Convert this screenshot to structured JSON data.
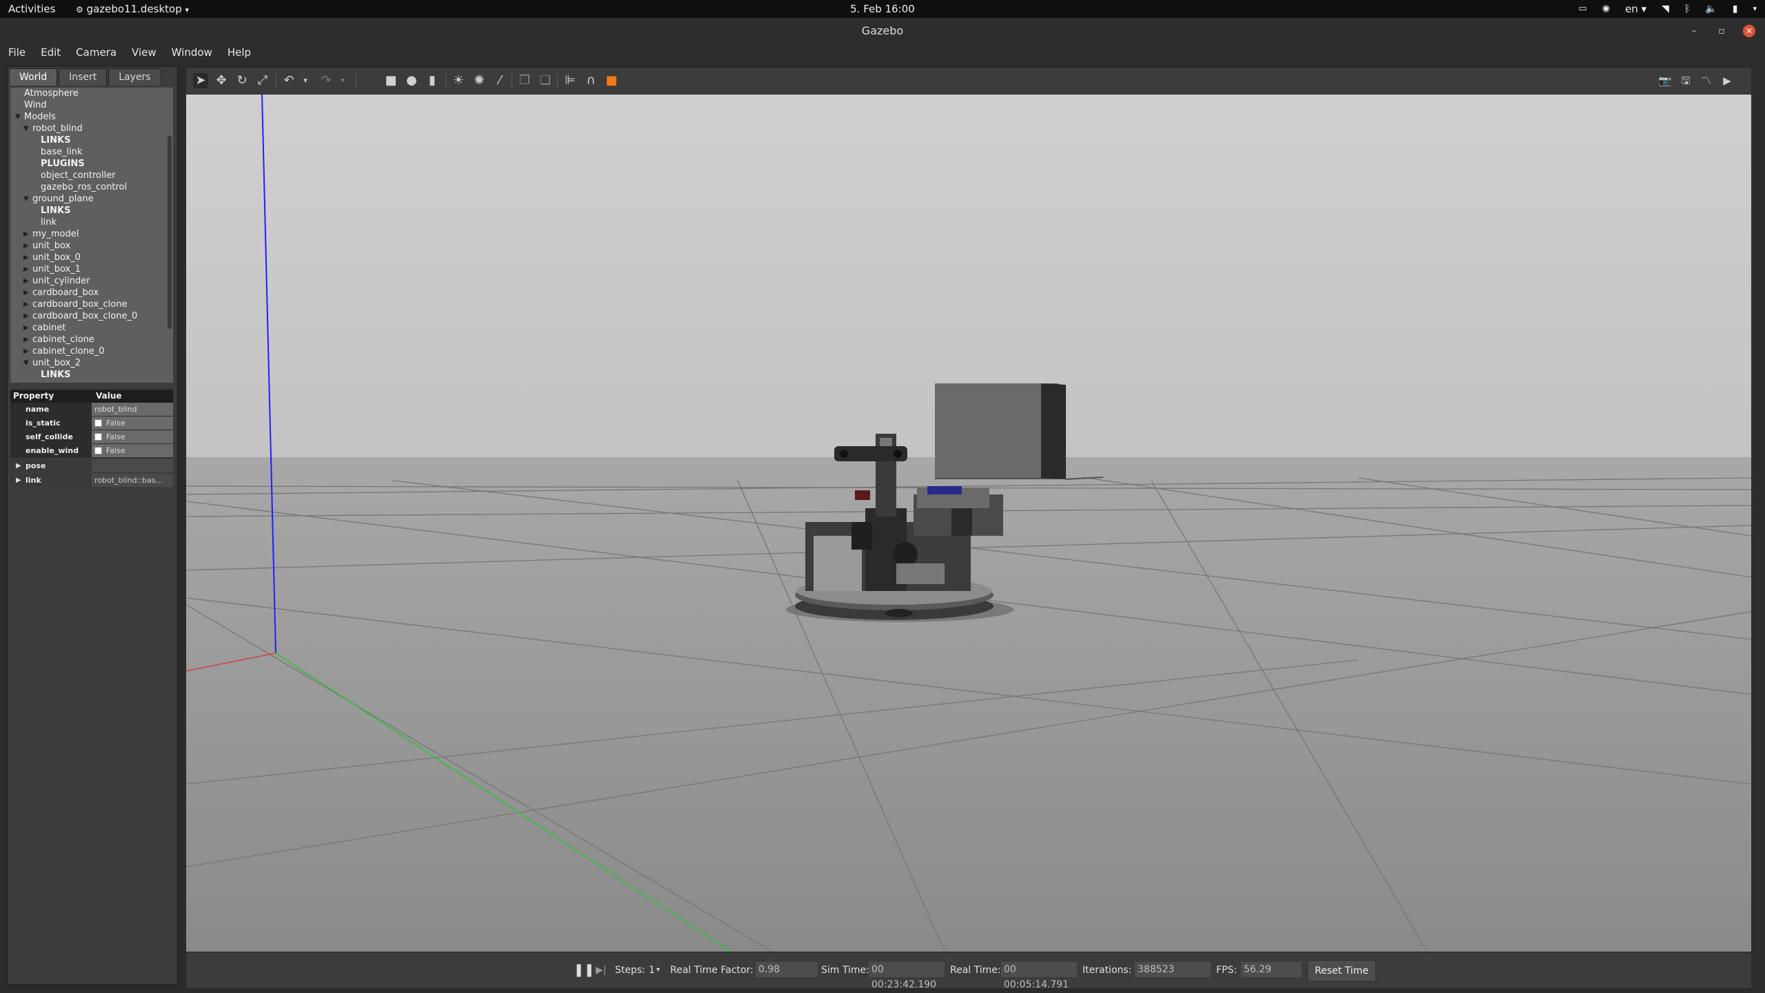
{
  "topbar": {
    "activities": "Activities",
    "app_menu": "gazebo11.desktop",
    "clock": "5. Feb  16:00",
    "language": "en"
  },
  "window": {
    "title": "Gazebo"
  },
  "menu": {
    "file": "File",
    "edit": "Edit",
    "camera": "Camera",
    "view": "View",
    "window": "Window",
    "help": "Help"
  },
  "tabs": {
    "world": "World",
    "insert": "Insert",
    "layers": "Layers"
  },
  "tree": {
    "items": [
      {
        "label": "Atmosphere",
        "level": 1,
        "arrow": "none",
        "bold": false
      },
      {
        "label": "Wind",
        "level": 1,
        "arrow": "none",
        "bold": false
      },
      {
        "label": "Models",
        "level": 1,
        "arrow": "down",
        "bold": false
      },
      {
        "label": "robot_blind",
        "level": 2,
        "arrow": "down",
        "bold": false
      },
      {
        "label": "LINKS",
        "level": 3,
        "arrow": "none",
        "bold": true
      },
      {
        "label": "base_link",
        "level": 3,
        "arrow": "none",
        "bold": false
      },
      {
        "label": "PLUGINS",
        "level": 3,
        "arrow": "none",
        "bold": true
      },
      {
        "label": "object_controller",
        "level": 3,
        "arrow": "none",
        "bold": false
      },
      {
        "label": "gazebo_ros_control",
        "level": 3,
        "arrow": "none",
        "bold": false
      },
      {
        "label": "ground_plane",
        "level": 2,
        "arrow": "down",
        "bold": false
      },
      {
        "label": "LINKS",
        "level": 3,
        "arrow": "none",
        "bold": true
      },
      {
        "label": "link",
        "level": 3,
        "arrow": "none",
        "bold": false
      },
      {
        "label": "my_model",
        "level": 2,
        "arrow": "right",
        "bold": false
      },
      {
        "label": "unit_box",
        "level": 2,
        "arrow": "right",
        "bold": false
      },
      {
        "label": "unit_box_0",
        "level": 2,
        "arrow": "right",
        "bold": false
      },
      {
        "label": "unit_box_1",
        "level": 2,
        "arrow": "right",
        "bold": false
      },
      {
        "label": "unit_cylinder",
        "level": 2,
        "arrow": "right",
        "bold": false
      },
      {
        "label": "cardboard_box",
        "level": 2,
        "arrow": "right",
        "bold": false
      },
      {
        "label": "cardboard_box_clone",
        "level": 2,
        "arrow": "right",
        "bold": false
      },
      {
        "label": "cardboard_box_clone_0",
        "level": 2,
        "arrow": "right",
        "bold": false
      },
      {
        "label": "cabinet",
        "level": 2,
        "arrow": "right",
        "bold": false
      },
      {
        "label": "cabinet_clone",
        "level": 2,
        "arrow": "right",
        "bold": false
      },
      {
        "label": "cabinet_clone_0",
        "level": 2,
        "arrow": "right",
        "bold": false
      },
      {
        "label": "unit_box_2",
        "level": 2,
        "arrow": "down",
        "bold": false
      },
      {
        "label": "LINKS",
        "level": 3,
        "arrow": "none",
        "bold": true
      }
    ]
  },
  "properties": {
    "header_property": "Property",
    "header_value": "Value",
    "name_key": "name",
    "name_value": "robot_blind",
    "is_static_key": "is_static",
    "is_static_value": "False",
    "self_collide_key": "self_collide",
    "self_collide_value": "False",
    "enable_wind_key": "enable_wind",
    "enable_wind_value": "False",
    "pose_key": "pose",
    "link_key": "link",
    "link_value": "robot_blind::bas..."
  },
  "simbar": {
    "steps_label": "Steps:",
    "steps_value": "1",
    "rtf_label": "Real Time Factor:",
    "rtf_value": "0.98",
    "simtime_label": "Sim Time:",
    "simtime_value": "00 00:23:42.190",
    "realtime_label": "Real Time:",
    "realtime_value": "00 00:05:14.791",
    "iterations_label": "Iterations:",
    "iterations_value": "388523",
    "fps_label": "FPS:",
    "fps_value": "56.29",
    "reset_label": "Reset Time"
  },
  "colors": {
    "sky": "#c9c9c9",
    "ground": "#8e8e8e",
    "grid_line": "#6d6d6d",
    "z_axis": "#2020ff",
    "x_axis": "#d04040",
    "y_axis": "#30c030",
    "close_button": "#e0553a"
  }
}
